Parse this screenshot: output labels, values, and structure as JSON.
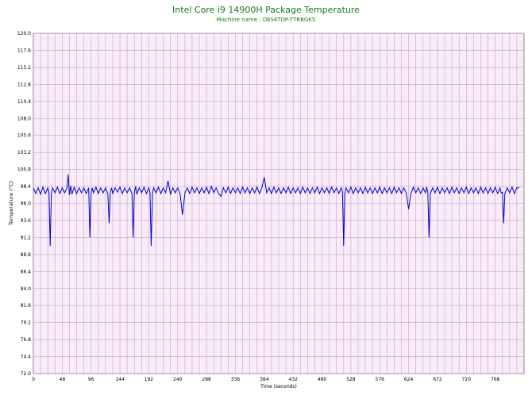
{
  "chart_data": {
    "type": "line",
    "title": "Intel Core i9 14900H Package Temperature",
    "subtitle": "Machine name : DESKTOP-TTRBGK5",
    "xlabel": "Time (seconds)",
    "ylabel": "Temperature (°C)",
    "xlim": [
      0,
      816
    ],
    "ylim": [
      72.0,
      120.0
    ],
    "xticks": [
      0,
      48,
      96,
      144,
      192,
      240,
      288,
      336,
      384,
      432,
      480,
      528,
      576,
      624,
      672,
      720,
      768
    ],
    "yticks": [
      72.0,
      74.4,
      76.8,
      79.2,
      81.6,
      84.0,
      86.4,
      88.8,
      91.2,
      93.6,
      96.0,
      98.4,
      100.8,
      103.2,
      105.6,
      108.0,
      110.4,
      112.8,
      115.2,
      117.6,
      120.0
    ],
    "ytick_labels": [
      "72.0",
      "74.4",
      "76.8",
      "79.2",
      "81.6",
      "84.0",
      "86.4",
      "88.8",
      "91.2",
      "93.6",
      "96.0",
      "98.4",
      "100.8",
      "103.2",
      "105.6",
      "108.0",
      "110.4",
      "112.8",
      "115.2",
      "117.6",
      "120.0"
    ],
    "grid": true,
    "colors": {
      "plot_background": "#f8ecf8",
      "grid": "#c9a0c9",
      "line": "#0000cc",
      "title": "#1a7a1a"
    },
    "series": [
      {
        "values": {
          "x": [
            0,
            4,
            8,
            12,
            16,
            20,
            24,
            26,
            28,
            30,
            32,
            36,
            40,
            44,
            48,
            52,
            56,
            58,
            60,
            62,
            64,
            68,
            72,
            76,
            80,
            84,
            88,
            92,
            94,
            96,
            98,
            100,
            104,
            108,
            112,
            116,
            120,
            124,
            126,
            128,
            130,
            132,
            136,
            140,
            144,
            148,
            152,
            156,
            160,
            164,
            166,
            168,
            170,
            172,
            176,
            180,
            184,
            188,
            192,
            194,
            196,
            198,
            200,
            204,
            208,
            212,
            216,
            220,
            224,
            228,
            232,
            236,
            240,
            244,
            248,
            252,
            256,
            260,
            264,
            268,
            272,
            276,
            280,
            284,
            288,
            292,
            296,
            300,
            304,
            308,
            312,
            316,
            320,
            324,
            328,
            332,
            336,
            340,
            344,
            348,
            352,
            356,
            360,
            364,
            368,
            372,
            376,
            380,
            384,
            388,
            392,
            396,
            400,
            404,
            408,
            412,
            416,
            420,
            424,
            428,
            432,
            436,
            440,
            444,
            448,
            452,
            456,
            460,
            464,
            468,
            472,
            476,
            480,
            484,
            488,
            492,
            496,
            500,
            504,
            508,
            512,
            514,
            516,
            518,
            520,
            524,
            528,
            532,
            536,
            540,
            544,
            548,
            552,
            556,
            560,
            564,
            568,
            572,
            576,
            580,
            584,
            588,
            592,
            596,
            600,
            604,
            608,
            612,
            616,
            620,
            624,
            628,
            632,
            636,
            640,
            644,
            648,
            652,
            654,
            656,
            658,
            660,
            664,
            668,
            672,
            676,
            680,
            684,
            688,
            692,
            696,
            700,
            704,
            708,
            712,
            716,
            720,
            724,
            728,
            732,
            736,
            740,
            744,
            748,
            752,
            756,
            760,
            764,
            768,
            772,
            776,
            778,
            780,
            782,
            784,
            788,
            792,
            796,
            800,
            804,
            808,
            812,
            816
          ],
          "y": [
            98.2,
            97.4,
            98.2,
            97.3,
            98.3,
            97.4,
            98.2,
            97.6,
            90.0,
            97.4,
            98.2,
            97.5,
            98.3,
            97.4,
            98.2,
            97.5,
            98.2,
            100.1,
            97.2,
            98.5,
            97.3,
            98.3,
            97.4,
            98.2,
            97.5,
            98.2,
            97.4,
            98.2,
            91.2,
            97.4,
            98.2,
            97.5,
            98.3,
            97.4,
            98.2,
            97.5,
            98.2,
            97.3,
            93.2,
            97.5,
            98.2,
            97.4,
            98.2,
            97.6,
            98.3,
            97.4,
            98.2,
            97.5,
            98.2,
            97.4,
            91.2,
            97.5,
            98.4,
            97.3,
            98.2,
            97.5,
            98.3,
            97.4,
            98.2,
            97.6,
            90.0,
            97.4,
            98.2,
            97.5,
            98.3,
            97.4,
            98.2,
            97.5,
            99.2,
            97.3,
            98.2,
            97.5,
            98.2,
            97.4,
            94.4,
            97.5,
            98.2,
            97.4,
            98.3,
            97.5,
            98.2,
            97.4,
            98.2,
            97.5,
            98.3,
            97.4,
            98.4,
            97.5,
            98.2,
            97.4,
            97.0,
            98.2,
            97.5,
            98.3,
            97.4,
            98.2,
            97.5,
            98.2,
            97.4,
            98.3,
            97.5,
            98.2,
            97.4,
            98.2,
            97.5,
            98.3,
            97.4,
            98.2,
            99.7,
            97.5,
            98.2,
            97.4,
            98.3,
            97.5,
            98.2,
            97.4,
            98.2,
            97.5,
            98.3,
            97.4,
            98.2,
            97.5,
            98.2,
            97.4,
            98.3,
            97.5,
            98.2,
            97.4,
            98.2,
            97.5,
            98.3,
            97.4,
            98.2,
            97.5,
            98.2,
            97.4,
            98.3,
            97.5,
            98.2,
            97.4,
            98.2,
            97.6,
            90.0,
            97.4,
            98.2,
            97.5,
            98.3,
            97.4,
            98.2,
            97.5,
            98.2,
            97.4,
            98.3,
            97.5,
            98.2,
            97.4,
            98.2,
            97.5,
            98.3,
            97.4,
            98.2,
            97.5,
            98.2,
            97.4,
            98.3,
            97.5,
            98.2,
            97.4,
            98.2,
            97.5,
            95.2,
            97.4,
            98.3,
            97.5,
            98.2,
            97.4,
            98.2,
            97.5,
            98.3,
            97.6,
            91.2,
            97.4,
            98.2,
            97.5,
            98.3,
            97.4,
            98.2,
            97.5,
            98.2,
            97.4,
            98.3,
            97.5,
            98.2,
            97.4,
            98.2,
            97.5,
            98.3,
            97.4,
            98.2,
            97.5,
            98.2,
            97.4,
            98.3,
            97.5,
            98.2,
            97.4,
            98.2,
            97.5,
            98.3,
            97.4,
            98.2,
            97.5,
            97.6,
            93.2,
            97.4,
            98.2,
            97.5,
            98.3,
            97.4,
            98.2,
            98.2
          ]
        }
      }
    ]
  }
}
